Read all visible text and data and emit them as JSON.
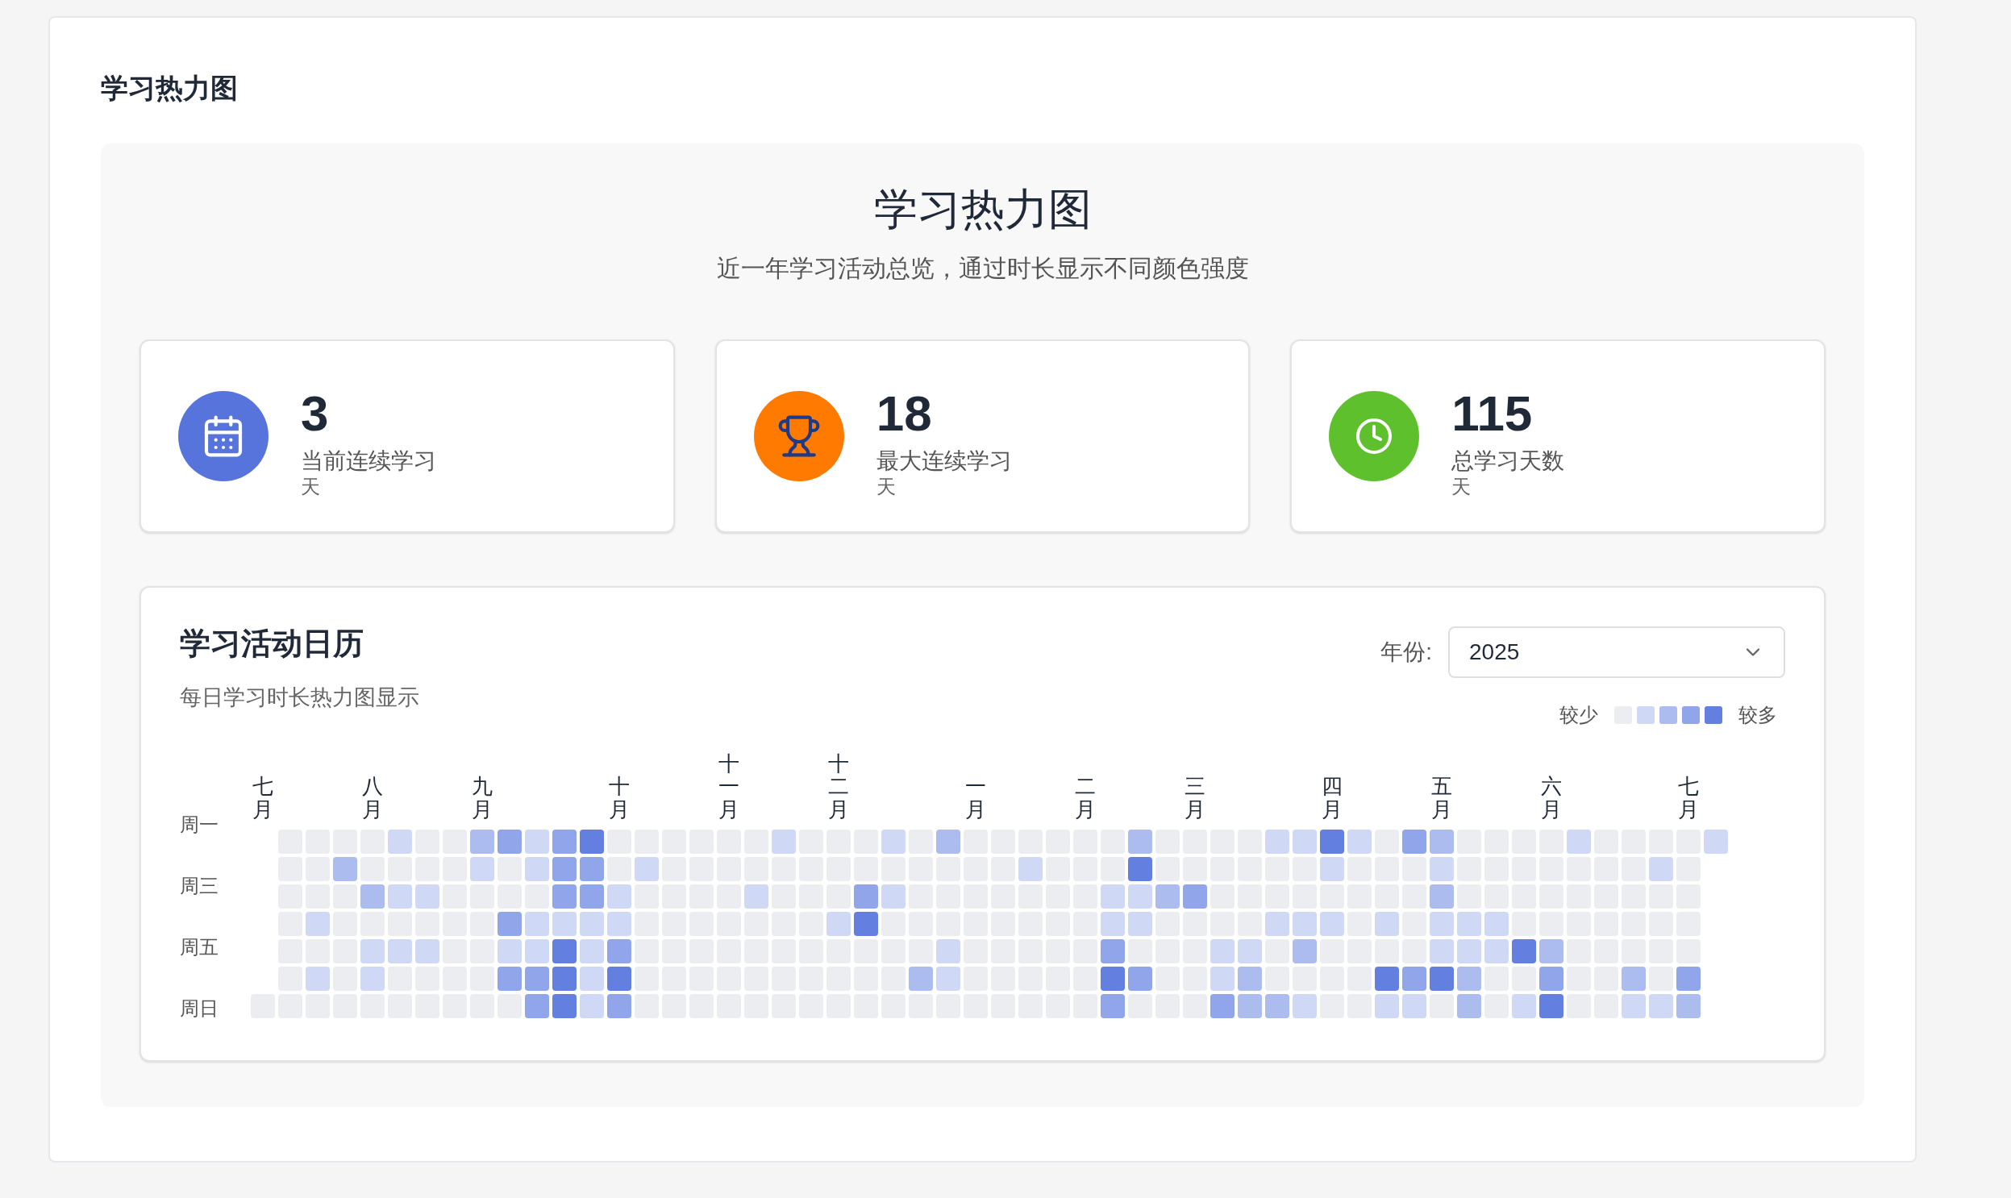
{
  "page_title": "学习热力图",
  "hero": {
    "title": "学习热力图",
    "subtitle": "近一年学习活动总览，通过时长显示不同颜色强度"
  },
  "stats": [
    {
      "kind": "calendar",
      "color": "#5674dc",
      "value": "3",
      "label": "当前连续学习",
      "unit": "天"
    },
    {
      "kind": "trophy",
      "color": "#ff7a00",
      "value": "18",
      "label": "最大连续学习",
      "unit": "天"
    },
    {
      "kind": "clock",
      "color": "#5fc02e",
      "value": "115",
      "label": "总学习天数",
      "unit": "天"
    }
  ],
  "calendar": {
    "title": "学习活动日历",
    "subtitle": "每日学习时长热力图显示",
    "year_label": "年份:",
    "year": "2025",
    "legend": {
      "less": "较少",
      "more": "较多",
      "swatches": [
        {
          "color": "#ebedf0"
        },
        {
          "color": "#cfd8f5"
        },
        {
          "color": "#adbcef"
        },
        {
          "color": "#91a5ea"
        },
        {
          "color": "#6380e0"
        }
      ]
    },
    "weekday_labels": [
      "周一",
      "周三",
      "周五",
      "周日"
    ],
    "weeks": [
      {
        "month": "七月",
        "days": [
          {
            "color": "#ebedf0"
          }
        ]
      },
      {
        "days": [
          {
            "color": "#ebedf0"
          },
          {
            "color": "#ebedf0"
          },
          {
            "color": "#ebedf0"
          },
          {
            "color": "#ebedf0"
          },
          {
            "color": "#ebedf0"
          },
          {
            "color": "#ebedf0"
          },
          {
            "color": "#ebedf0"
          }
        ]
      },
      {
        "days": [
          {
            "color": "#ebedf0"
          },
          {
            "color": "#ebedf0"
          },
          {
            "color": "#ebedf0"
          },
          {
            "color": "#cfd8f5"
          },
          {
            "color": "#ebedf0"
          },
          {
            "color": "#cfd8f5"
          },
          {
            "color": "#ebedf0"
          }
        ]
      },
      {
        "days": [
          {
            "color": "#ebedf0"
          },
          {
            "color": "#adbcef"
          },
          {
            "color": "#ebedf0"
          },
          {
            "color": "#ebedf0"
          },
          {
            "color": "#ebedf0"
          },
          {
            "color": "#ebedf0"
          },
          {
            "color": "#ebedf0"
          }
        ]
      },
      {
        "month": "八月",
        "days": [
          {
            "color": "#ebedf0"
          },
          {
            "color": "#ebedf0"
          },
          {
            "color": "#adbcef"
          },
          {
            "color": "#ebedf0"
          },
          {
            "color": "#cfd8f5"
          },
          {
            "color": "#cfd8f5"
          },
          {
            "color": "#ebedf0"
          }
        ]
      },
      {
        "days": [
          {
            "color": "#cfd8f5"
          },
          {
            "color": "#ebedf0"
          },
          {
            "color": "#cfd8f5"
          },
          {
            "color": "#ebedf0"
          },
          {
            "color": "#cfd8f5"
          },
          {
            "color": "#ebedf0"
          },
          {
            "color": "#ebedf0"
          }
        ]
      },
      {
        "days": [
          {
            "color": "#ebedf0"
          },
          {
            "color": "#ebedf0"
          },
          {
            "color": "#cfd8f5"
          },
          {
            "color": "#ebedf0"
          },
          {
            "color": "#cfd8f5"
          },
          {
            "color": "#ebedf0"
          },
          {
            "color": "#ebedf0"
          }
        ]
      },
      {
        "days": [
          {
            "color": "#ebedf0"
          },
          {
            "color": "#ebedf0"
          },
          {
            "color": "#ebedf0"
          },
          {
            "color": "#ebedf0"
          },
          {
            "color": "#ebedf0"
          },
          {
            "color": "#ebedf0"
          },
          {
            "color": "#ebedf0"
          }
        ]
      },
      {
        "month": "九月",
        "days": [
          {
            "color": "#adbcef"
          },
          {
            "color": "#cfd8f5"
          },
          {
            "color": "#ebedf0"
          },
          {
            "color": "#ebedf0"
          },
          {
            "color": "#ebedf0"
          },
          {
            "color": "#ebedf0"
          },
          {
            "color": "#ebedf0"
          }
        ]
      },
      {
        "days": [
          {
            "color": "#91a5ea"
          },
          {
            "color": "#ebedf0"
          },
          {
            "color": "#ebedf0"
          },
          {
            "color": "#91a5ea"
          },
          {
            "color": "#cfd8f5"
          },
          {
            "color": "#91a5ea"
          },
          {
            "color": "#ebedf0"
          }
        ]
      },
      {
        "days": [
          {
            "color": "#cfd8f5"
          },
          {
            "color": "#cfd8f5"
          },
          {
            "color": "#ebedf0"
          },
          {
            "color": "#cfd8f5"
          },
          {
            "color": "#cfd8f5"
          },
          {
            "color": "#91a5ea"
          },
          {
            "color": "#91a5ea"
          }
        ]
      },
      {
        "days": [
          {
            "color": "#91a5ea"
          },
          {
            "color": "#91a5ea"
          },
          {
            "color": "#91a5ea"
          },
          {
            "color": "#cfd8f5"
          },
          {
            "color": "#6380e0"
          },
          {
            "color": "#6380e0"
          },
          {
            "color": "#6380e0"
          }
        ]
      },
      {
        "days": [
          {
            "color": "#6380e0"
          },
          {
            "color": "#91a5ea"
          },
          {
            "color": "#91a5ea"
          },
          {
            "color": "#cfd8f5"
          },
          {
            "color": "#cfd8f5"
          },
          {
            "color": "#cfd8f5"
          },
          {
            "color": "#cfd8f5"
          }
        ]
      },
      {
        "month": "十月",
        "days": [
          {
            "color": "#ebedf0"
          },
          {
            "color": "#ebedf0"
          },
          {
            "color": "#cfd8f5"
          },
          {
            "color": "#cfd8f5"
          },
          {
            "color": "#91a5ea"
          },
          {
            "color": "#6380e0"
          },
          {
            "color": "#91a5ea"
          }
        ]
      },
      {
        "days": [
          {
            "color": "#ebedf0"
          },
          {
            "color": "#cfd8f5"
          },
          {
            "color": "#ebedf0"
          },
          {
            "color": "#ebedf0"
          },
          {
            "color": "#ebedf0"
          },
          {
            "color": "#ebedf0"
          },
          {
            "color": "#ebedf0"
          }
        ]
      },
      {
        "days": [
          {
            "color": "#ebedf0"
          },
          {
            "color": "#ebedf0"
          },
          {
            "color": "#ebedf0"
          },
          {
            "color": "#ebedf0"
          },
          {
            "color": "#ebedf0"
          },
          {
            "color": "#ebedf0"
          },
          {
            "color": "#ebedf0"
          }
        ]
      },
      {
        "days": [
          {
            "color": "#ebedf0"
          },
          {
            "color": "#ebedf0"
          },
          {
            "color": "#ebedf0"
          },
          {
            "color": "#ebedf0"
          },
          {
            "color": "#ebedf0"
          },
          {
            "color": "#ebedf0"
          },
          {
            "color": "#ebedf0"
          }
        ]
      },
      {
        "month": "十一月",
        "days": [
          {
            "color": "#ebedf0"
          },
          {
            "color": "#ebedf0"
          },
          {
            "color": "#ebedf0"
          },
          {
            "color": "#ebedf0"
          },
          {
            "color": "#ebedf0"
          },
          {
            "color": "#ebedf0"
          },
          {
            "color": "#ebedf0"
          }
        ]
      },
      {
        "days": [
          {
            "color": "#ebedf0"
          },
          {
            "color": "#ebedf0"
          },
          {
            "color": "#cfd8f5"
          },
          {
            "color": "#ebedf0"
          },
          {
            "color": "#ebedf0"
          },
          {
            "color": "#ebedf0"
          },
          {
            "color": "#ebedf0"
          }
        ]
      },
      {
        "days": [
          {
            "color": "#cfd8f5"
          },
          {
            "color": "#ebedf0"
          },
          {
            "color": "#ebedf0"
          },
          {
            "color": "#ebedf0"
          },
          {
            "color": "#ebedf0"
          },
          {
            "color": "#ebedf0"
          },
          {
            "color": "#ebedf0"
          }
        ]
      },
      {
        "days": [
          {
            "color": "#ebedf0"
          },
          {
            "color": "#ebedf0"
          },
          {
            "color": "#ebedf0"
          },
          {
            "color": "#ebedf0"
          },
          {
            "color": "#ebedf0"
          },
          {
            "color": "#ebedf0"
          },
          {
            "color": "#ebedf0"
          }
        ]
      },
      {
        "month": "十二月",
        "days": [
          {
            "color": "#ebedf0"
          },
          {
            "color": "#ebedf0"
          },
          {
            "color": "#ebedf0"
          },
          {
            "color": "#cfd8f5"
          },
          {
            "color": "#ebedf0"
          },
          {
            "color": "#ebedf0"
          },
          {
            "color": "#ebedf0"
          }
        ]
      },
      {
        "days": [
          {
            "color": "#ebedf0"
          },
          {
            "color": "#ebedf0"
          },
          {
            "color": "#91a5ea"
          },
          {
            "color": "#6380e0"
          },
          {
            "color": "#ebedf0"
          },
          {
            "color": "#ebedf0"
          },
          {
            "color": "#ebedf0"
          }
        ]
      },
      {
        "days": [
          {
            "color": "#cfd8f5"
          },
          {
            "color": "#ebedf0"
          },
          {
            "color": "#cfd8f5"
          },
          {
            "color": "#ebedf0"
          },
          {
            "color": "#ebedf0"
          },
          {
            "color": "#ebedf0"
          },
          {
            "color": "#ebedf0"
          }
        ]
      },
      {
        "days": [
          {
            "color": "#ebedf0"
          },
          {
            "color": "#ebedf0"
          },
          {
            "color": "#ebedf0"
          },
          {
            "color": "#ebedf0"
          },
          {
            "color": "#ebedf0"
          },
          {
            "color": "#adbcef"
          },
          {
            "color": "#ebedf0"
          }
        ]
      },
      {
        "days": [
          {
            "color": "#adbcef"
          },
          {
            "color": "#ebedf0"
          },
          {
            "color": "#ebedf0"
          },
          {
            "color": "#ebedf0"
          },
          {
            "color": "#cfd8f5"
          },
          {
            "color": "#cfd8f5"
          },
          {
            "color": "#ebedf0"
          }
        ]
      },
      {
        "month": "一月",
        "days": [
          {
            "color": "#ebedf0"
          },
          {
            "color": "#ebedf0"
          },
          {
            "color": "#ebedf0"
          },
          {
            "color": "#ebedf0"
          },
          {
            "color": "#ebedf0"
          },
          {
            "color": "#ebedf0"
          },
          {
            "color": "#ebedf0"
          }
        ]
      },
      {
        "days": [
          {
            "color": "#ebedf0"
          },
          {
            "color": "#ebedf0"
          },
          {
            "color": "#ebedf0"
          },
          {
            "color": "#ebedf0"
          },
          {
            "color": "#ebedf0"
          },
          {
            "color": "#ebedf0"
          },
          {
            "color": "#ebedf0"
          }
        ]
      },
      {
        "days": [
          {
            "color": "#ebedf0"
          },
          {
            "color": "#cfd8f5"
          },
          {
            "color": "#ebedf0"
          },
          {
            "color": "#ebedf0"
          },
          {
            "color": "#ebedf0"
          },
          {
            "color": "#ebedf0"
          },
          {
            "color": "#ebedf0"
          }
        ]
      },
      {
        "days": [
          {
            "color": "#ebedf0"
          },
          {
            "color": "#ebedf0"
          },
          {
            "color": "#ebedf0"
          },
          {
            "color": "#ebedf0"
          },
          {
            "color": "#ebedf0"
          },
          {
            "color": "#ebedf0"
          },
          {
            "color": "#ebedf0"
          }
        ]
      },
      {
        "month": "二月",
        "days": [
          {
            "color": "#ebedf0"
          },
          {
            "color": "#ebedf0"
          },
          {
            "color": "#ebedf0"
          },
          {
            "color": "#ebedf0"
          },
          {
            "color": "#ebedf0"
          },
          {
            "color": "#ebedf0"
          },
          {
            "color": "#ebedf0"
          }
        ]
      },
      {
        "days": [
          {
            "color": "#ebedf0"
          },
          {
            "color": "#ebedf0"
          },
          {
            "color": "#cfd8f5"
          },
          {
            "color": "#cfd8f5"
          },
          {
            "color": "#91a5ea"
          },
          {
            "color": "#6380e0"
          },
          {
            "color": "#91a5ea"
          }
        ]
      },
      {
        "days": [
          {
            "color": "#adbcef"
          },
          {
            "color": "#6380e0"
          },
          {
            "color": "#cfd8f5"
          },
          {
            "color": "#cfd8f5"
          },
          {
            "color": "#ebedf0"
          },
          {
            "color": "#91a5ea"
          },
          {
            "color": "#ebedf0"
          }
        ]
      },
      {
        "days": [
          {
            "color": "#ebedf0"
          },
          {
            "color": "#ebedf0"
          },
          {
            "color": "#adbcef"
          },
          {
            "color": "#ebedf0"
          },
          {
            "color": "#ebedf0"
          },
          {
            "color": "#ebedf0"
          },
          {
            "color": "#ebedf0"
          }
        ]
      },
      {
        "month": "三月",
        "days": [
          {
            "color": "#ebedf0"
          },
          {
            "color": "#ebedf0"
          },
          {
            "color": "#91a5ea"
          },
          {
            "color": "#ebedf0"
          },
          {
            "color": "#ebedf0"
          },
          {
            "color": "#ebedf0"
          },
          {
            "color": "#ebedf0"
          }
        ]
      },
      {
        "days": [
          {
            "color": "#ebedf0"
          },
          {
            "color": "#ebedf0"
          },
          {
            "color": "#ebedf0"
          },
          {
            "color": "#ebedf0"
          },
          {
            "color": "#cfd8f5"
          },
          {
            "color": "#cfd8f5"
          },
          {
            "color": "#91a5ea"
          }
        ]
      },
      {
        "days": [
          {
            "color": "#ebedf0"
          },
          {
            "color": "#ebedf0"
          },
          {
            "color": "#ebedf0"
          },
          {
            "color": "#ebedf0"
          },
          {
            "color": "#cfd8f5"
          },
          {
            "color": "#adbcef"
          },
          {
            "color": "#adbcef"
          }
        ]
      },
      {
        "days": [
          {
            "color": "#cfd8f5"
          },
          {
            "color": "#ebedf0"
          },
          {
            "color": "#ebedf0"
          },
          {
            "color": "#cfd8f5"
          },
          {
            "color": "#ebedf0"
          },
          {
            "color": "#ebedf0"
          },
          {
            "color": "#adbcef"
          }
        ]
      },
      {
        "days": [
          {
            "color": "#cfd8f5"
          },
          {
            "color": "#ebedf0"
          },
          {
            "color": "#ebedf0"
          },
          {
            "color": "#cfd8f5"
          },
          {
            "color": "#adbcef"
          },
          {
            "color": "#ebedf0"
          },
          {
            "color": "#cfd8f5"
          }
        ]
      },
      {
        "month": "四月",
        "days": [
          {
            "color": "#6380e0"
          },
          {
            "color": "#cfd8f5"
          },
          {
            "color": "#ebedf0"
          },
          {
            "color": "#cfd8f5"
          },
          {
            "color": "#ebedf0"
          },
          {
            "color": "#ebedf0"
          },
          {
            "color": "#ebedf0"
          }
        ]
      },
      {
        "days": [
          {
            "color": "#cfd8f5"
          },
          {
            "color": "#ebedf0"
          },
          {
            "color": "#ebedf0"
          },
          {
            "color": "#ebedf0"
          },
          {
            "color": "#ebedf0"
          },
          {
            "color": "#ebedf0"
          },
          {
            "color": "#ebedf0"
          }
        ]
      },
      {
        "days": [
          {
            "color": "#ebedf0"
          },
          {
            "color": "#ebedf0"
          },
          {
            "color": "#ebedf0"
          },
          {
            "color": "#cfd8f5"
          },
          {
            "color": "#ebedf0"
          },
          {
            "color": "#6380e0"
          },
          {
            "color": "#cfd8f5"
          }
        ]
      },
      {
        "days": [
          {
            "color": "#91a5ea"
          },
          {
            "color": "#ebedf0"
          },
          {
            "color": "#ebedf0"
          },
          {
            "color": "#ebedf0"
          },
          {
            "color": "#ebedf0"
          },
          {
            "color": "#91a5ea"
          },
          {
            "color": "#cfd8f5"
          }
        ]
      },
      {
        "month": "五月",
        "days": [
          {
            "color": "#adbcef"
          },
          {
            "color": "#cfd8f5"
          },
          {
            "color": "#adbcef"
          },
          {
            "color": "#cfd8f5"
          },
          {
            "color": "#cfd8f5"
          },
          {
            "color": "#6380e0"
          },
          {
            "color": "#ebedf0"
          }
        ]
      },
      {
        "days": [
          {
            "color": "#ebedf0"
          },
          {
            "color": "#ebedf0"
          },
          {
            "color": "#ebedf0"
          },
          {
            "color": "#cfd8f5"
          },
          {
            "color": "#cfd8f5"
          },
          {
            "color": "#adbcef"
          },
          {
            "color": "#adbcef"
          }
        ]
      },
      {
        "days": [
          {
            "color": "#ebedf0"
          },
          {
            "color": "#ebedf0"
          },
          {
            "color": "#ebedf0"
          },
          {
            "color": "#cfd8f5"
          },
          {
            "color": "#cfd8f5"
          },
          {
            "color": "#ebedf0"
          },
          {
            "color": "#ebedf0"
          }
        ]
      },
      {
        "days": [
          {
            "color": "#ebedf0"
          },
          {
            "color": "#ebedf0"
          },
          {
            "color": "#ebedf0"
          },
          {
            "color": "#ebedf0"
          },
          {
            "color": "#6380e0"
          },
          {
            "color": "#ebedf0"
          },
          {
            "color": "#cfd8f5"
          }
        ]
      },
      {
        "month": "六月",
        "days": [
          {
            "color": "#ebedf0"
          },
          {
            "color": "#ebedf0"
          },
          {
            "color": "#ebedf0"
          },
          {
            "color": "#ebedf0"
          },
          {
            "color": "#adbcef"
          },
          {
            "color": "#91a5ea"
          },
          {
            "color": "#6380e0"
          }
        ]
      },
      {
        "days": [
          {
            "color": "#cfd8f5"
          },
          {
            "color": "#ebedf0"
          },
          {
            "color": "#ebedf0"
          },
          {
            "color": "#ebedf0"
          },
          {
            "color": "#ebedf0"
          },
          {
            "color": "#ebedf0"
          },
          {
            "color": "#ebedf0"
          }
        ]
      },
      {
        "days": [
          {
            "color": "#ebedf0"
          },
          {
            "color": "#ebedf0"
          },
          {
            "color": "#ebedf0"
          },
          {
            "color": "#ebedf0"
          },
          {
            "color": "#ebedf0"
          },
          {
            "color": "#ebedf0"
          },
          {
            "color": "#ebedf0"
          }
        ]
      },
      {
        "days": [
          {
            "color": "#ebedf0"
          },
          {
            "color": "#ebedf0"
          },
          {
            "color": "#ebedf0"
          },
          {
            "color": "#ebedf0"
          },
          {
            "color": "#ebedf0"
          },
          {
            "color": "#adbcef"
          },
          {
            "color": "#cfd8f5"
          }
        ]
      },
      {
        "days": [
          {
            "color": "#ebedf0"
          },
          {
            "color": "#cfd8f5"
          },
          {
            "color": "#ebedf0"
          },
          {
            "color": "#ebedf0"
          },
          {
            "color": "#ebedf0"
          },
          {
            "color": "#ebedf0"
          },
          {
            "color": "#cfd8f5"
          }
        ]
      },
      {
        "month": "七月",
        "days": [
          {
            "color": "#ebedf0"
          },
          {
            "color": "#ebedf0"
          },
          {
            "color": "#ebedf0"
          },
          {
            "color": "#ebedf0"
          },
          {
            "color": "#ebedf0"
          },
          {
            "color": "#91a5ea"
          },
          {
            "color": "#adbcef"
          }
        ]
      },
      {
        "days": [
          {
            "color": "#cfd8f5"
          }
        ]
      }
    ]
  }
}
